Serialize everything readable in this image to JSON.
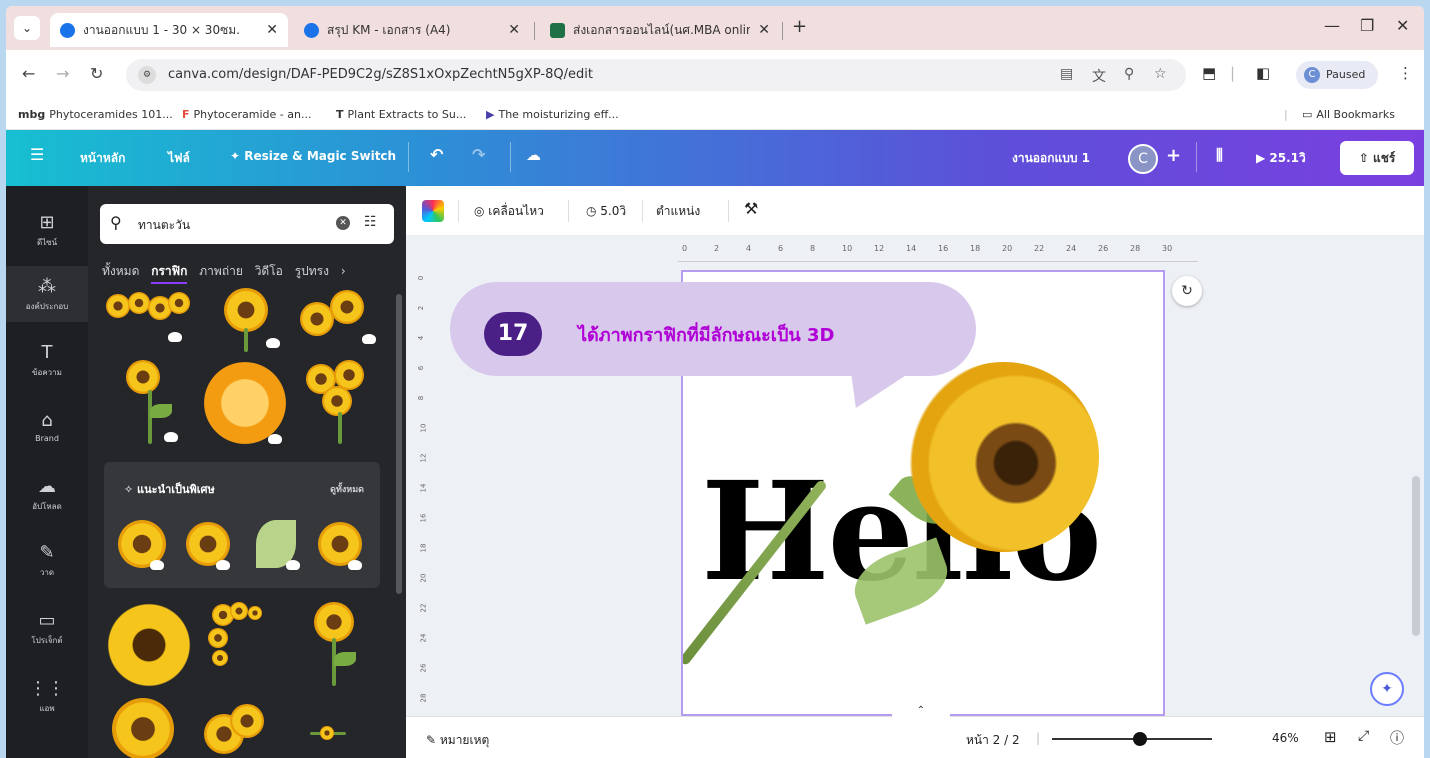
{
  "browser": {
    "tabs": [
      {
        "title": "งานออกแบบ 1 - 30 × 30ซม.",
        "active": true,
        "favicon_color": "#1a73e8"
      },
      {
        "title": "สรุป KM - เอกสาร (A4)",
        "active": false,
        "favicon_color": "#1a73e8"
      },
      {
        "title": "ส่งเอกสารออนไลน์(นศ.MBA online",
        "active": false,
        "favicon_color": "#1e7145"
      }
    ],
    "url": "canva.com/design/DAF-PED9C2g/sZ8S1xOxpZechtN5gXP-8Q/edit",
    "profile_status": "Paused",
    "profile_initial": "C",
    "bookmarks": [
      "Phytoceramides 101...",
      "Phytoceramide - an...",
      "Plant Extracts to Su...",
      "The moisturizing eff..."
    ],
    "bookmark_icons": [
      "mbg",
      "",
      "T",
      ""
    ],
    "all_bookmarks": "All Bookmarks"
  },
  "canva_header": {
    "home": "หน้าหลัก",
    "file": "ไฟล์",
    "resize": "Resize & Magic Switch",
    "design_name": "งานออกแบบ 1",
    "avatar_initial": "C",
    "timer": "25.1วิ",
    "share": "แชร์"
  },
  "rail": [
    {
      "icon": "layout-icon",
      "glyph": "⊞",
      "label": "ดีไซน์"
    },
    {
      "icon": "elements-icon",
      "glyph": "⁂",
      "label": "องค์ประกอบ",
      "selected": true
    },
    {
      "icon": "text-icon",
      "glyph": "T",
      "label": "ข้อความ"
    },
    {
      "icon": "brand-icon",
      "glyph": "⌂",
      "label": "Brand"
    },
    {
      "icon": "upload-icon",
      "glyph": "☁",
      "label": "อัปโหลด"
    },
    {
      "icon": "draw-icon",
      "glyph": "✎",
      "label": "วาด"
    },
    {
      "icon": "folder-icon",
      "glyph": "▭",
      "label": "โปรเจ็กต์"
    },
    {
      "icon": "apps-icon",
      "glyph": "⋮⋮",
      "label": "แอพ"
    }
  ],
  "panel": {
    "search_value": "ทานตะวัน",
    "categories": [
      "ทั้งหมด",
      "กราฟิก",
      "ภาพถ่าย",
      "วิดีโอ",
      "รูปทรง"
    ],
    "active_category": "กราฟิก",
    "recommend_title": "แนะนำเป็นพิเศษ",
    "recommend_all": "ดูทั้งหมด"
  },
  "toolbar": {
    "animate": "เคลื่อนไหว",
    "duration": "5.0วิ",
    "position": "ตำแหน่ง"
  },
  "ruler": {
    "h_ticks": [
      "0",
      "2",
      "4",
      "6",
      "8",
      "10",
      "12",
      "14",
      "16",
      "18",
      "20",
      "22",
      "24",
      "26",
      "28",
      "30"
    ],
    "v_ticks": [
      "0",
      "2",
      "4",
      "6",
      "8",
      "10",
      "12",
      "14",
      "16",
      "18",
      "20",
      "22",
      "24",
      "26",
      "28"
    ]
  },
  "canvas": {
    "text": "Hello",
    "annotation_number": "17",
    "annotation_text": "ได้ภาพกราฟิกที่มีลักษณะเป็น 3D"
  },
  "footer": {
    "notes": "หมายเหตุ",
    "page": "หน้า 2 / 2",
    "zoom": "46%",
    "zoom_fraction": 0.55
  }
}
